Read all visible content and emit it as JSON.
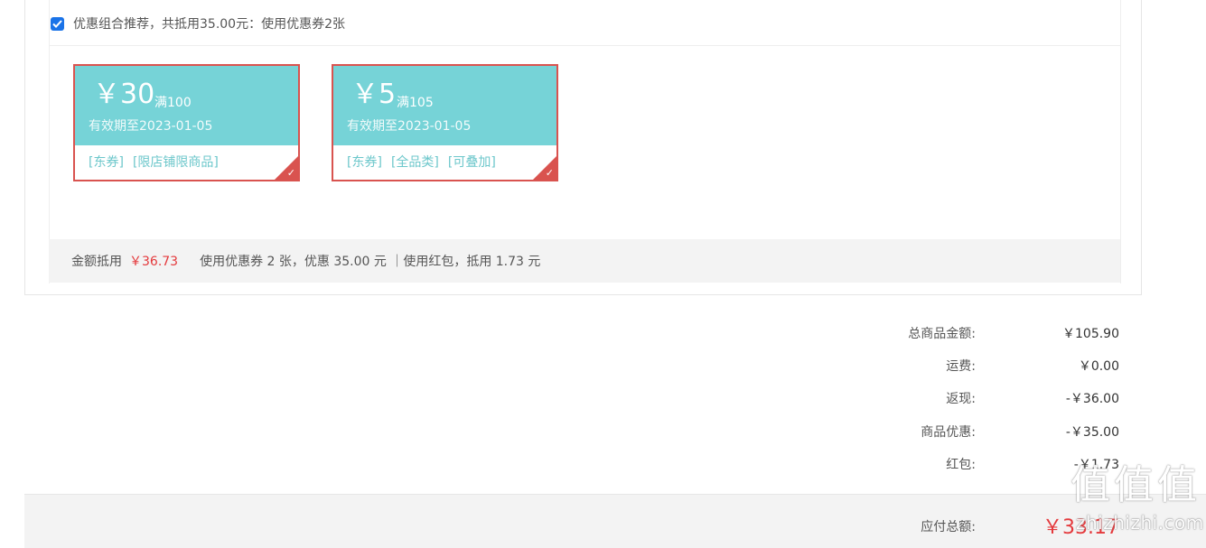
{
  "combo": {
    "checked": true,
    "text": "优惠组合推荐，共抵用35.00元：使用优惠券2张"
  },
  "coupons": [
    {
      "amount": "￥30",
      "condition": "满100",
      "valid": "有效期至2023-01-05",
      "tags": [
        "[东券]",
        "[限店铺限商品]"
      ],
      "selected": true
    },
    {
      "amount": "￥5",
      "condition": "满105",
      "valid": "有效期至2023-01-05",
      "tags": [
        "[东券]",
        "[全品类]",
        "[可叠加]"
      ],
      "selected": true
    }
  ],
  "summary": {
    "label": "金额抵用",
    "amount": "￥36.73",
    "detail": "使用优惠券 2 张，优惠 35.00 元 ｜使用红包，抵用 1.73 元"
  },
  "totals": [
    {
      "label": "总商品金额:",
      "value": "￥105.90"
    },
    {
      "label": "运费:",
      "value": "￥0.00"
    },
    {
      "label": "返现:",
      "value": "-￥36.00"
    },
    {
      "label": "商品优惠:",
      "value": "-￥35.00"
    },
    {
      "label": "红包:",
      "value": "-￥1.73"
    }
  ],
  "pay": {
    "label": "应付总额:",
    "value": "￥33.17"
  },
  "watermark": {
    "glyph": "值",
    "url": "zhizhizhi.com"
  },
  "colors": {
    "accent_red": "#e4393c",
    "coupon_border": "#d9534f",
    "coupon_teal": "#76d3d7",
    "checkbox_blue": "#1a73e8"
  }
}
